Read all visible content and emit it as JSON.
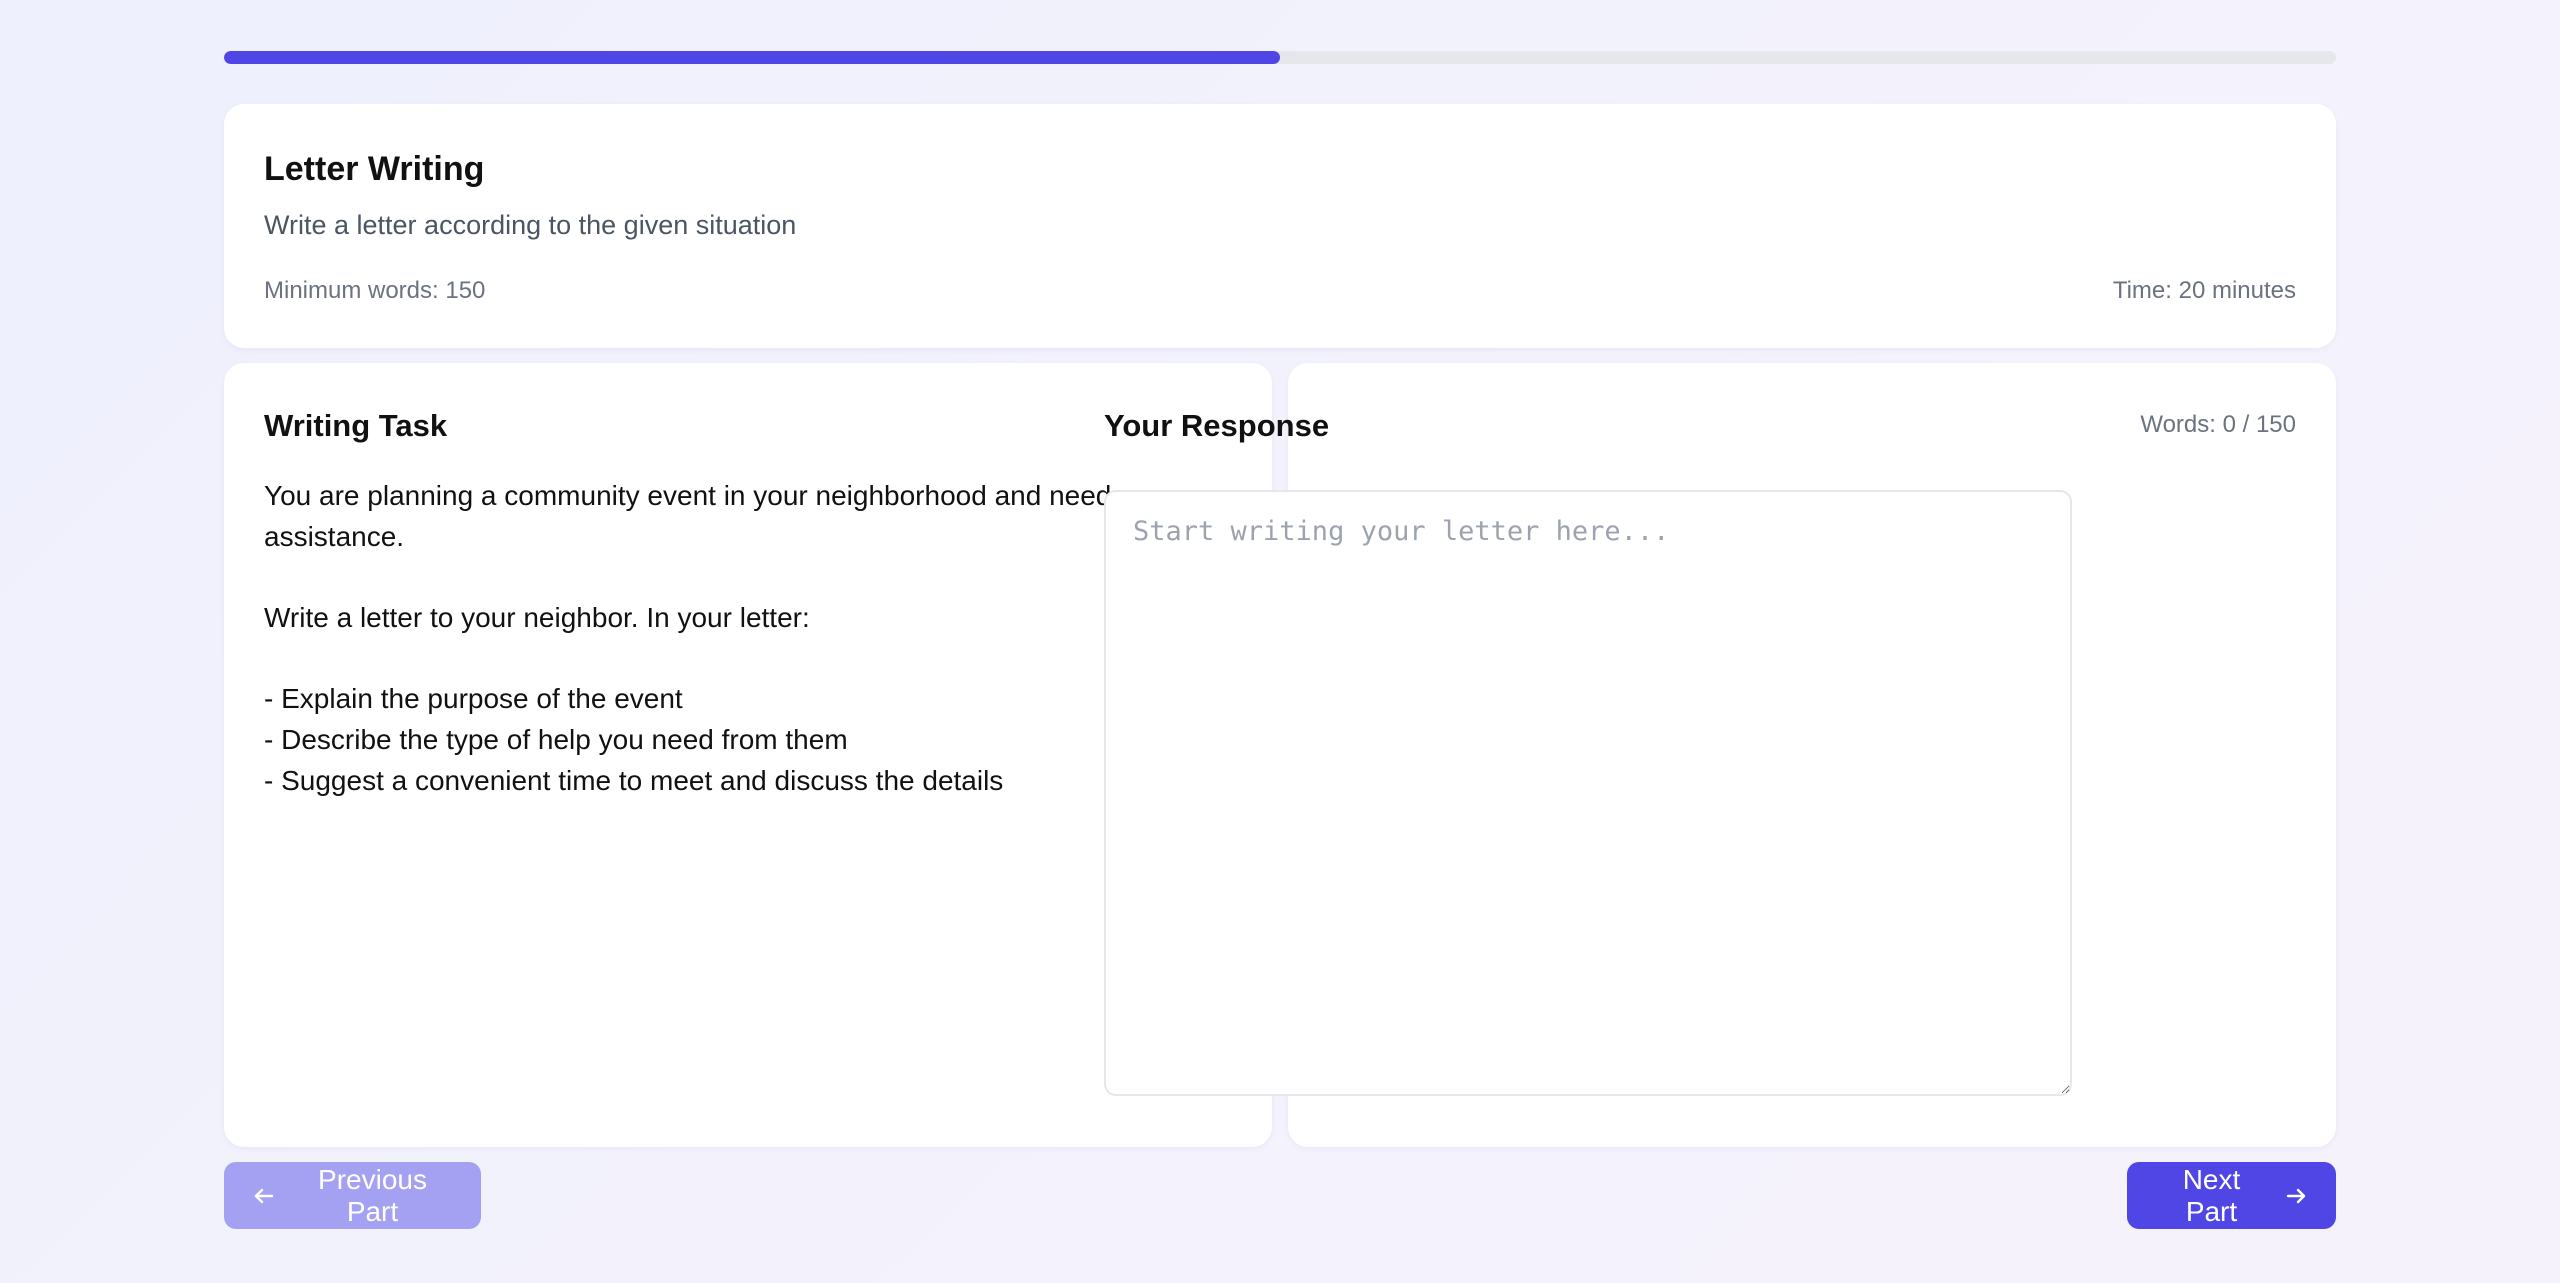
{
  "progress": {
    "fraction": 0.5
  },
  "header": {
    "title": "Letter Writing",
    "subtitle": "Write a letter according to the given situation",
    "min_words": "Minimum words: 150",
    "time": "Time: 20 minutes"
  },
  "task": {
    "title": "Writing Task",
    "lines": [
      "You are planning a community event in your neighborhood and need some assistance.",
      "",
      "Write a letter to your neighbor. In your letter:",
      "",
      "- Explain the purpose of the event",
      "- Describe the type of help you need from them",
      "- Suggest a convenient time to meet and discuss the details"
    ]
  },
  "response": {
    "title": "Your Response",
    "word_count": "Words: 0 / 150",
    "placeholder": "Start writing your letter here...",
    "value": ""
  },
  "nav": {
    "prev_label": "Previous Part",
    "next_label": "Next Part"
  },
  "colors": {
    "accent": "#4f46e5",
    "accent_disabled": "#a5a1f2"
  },
  "icons": {
    "prev": "arrow-left-icon",
    "next": "arrow-right-icon"
  }
}
